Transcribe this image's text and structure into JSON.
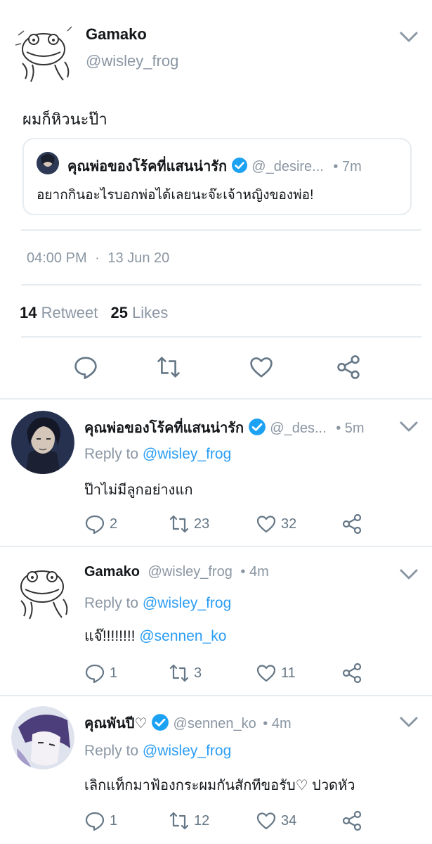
{
  "main_tweet": {
    "display_name": "Gamako",
    "handle": "@wisley_frog",
    "text": "ผมก็หิวนะป๊า",
    "quoted": {
      "display_name": "คุณพ่อของโร้คที่แสนน่ารัก",
      "handle": "@_desire...",
      "time": "• 7m",
      "text": "อยากกินอะไรบอกพ่อได้เลยนะจ๊ะเจ้าหญิงของพ่อ!"
    },
    "timestamp": "04:00 PM",
    "date_sep": "·",
    "date": "13 Jun 20",
    "retweet_count": "14",
    "retweet_label": "Retweet",
    "likes_count": "25",
    "likes_label": "Likes",
    "icons": [
      "reply-icon",
      "retweet-icon",
      "like-icon",
      "share-icon"
    ]
  },
  "replies": [
    {
      "display_name": "คุณพ่อของโร้คที่แสนน่ารัก",
      "handle": "@_des...",
      "time": "• 5m",
      "reply_prefix": "Reply to",
      "reply_to": "@wisley_frog",
      "text": "ป๊าไม่มีลูกอย่างแก",
      "mention": "",
      "replies": "2",
      "retweets": "23",
      "likes": "32"
    },
    {
      "display_name": "Gamako",
      "handle": "@wisley_frog",
      "time": "• 4m",
      "reply_prefix": "Reply to",
      "reply_to": "@wisley_frog",
      "text": "แจ๊!!!!!!!!",
      "mention": "@sennen_ko",
      "replies": "1",
      "retweets": "3",
      "likes": "11"
    },
    {
      "display_name": "คุณพันปี♡",
      "handle": "@sennen_ko",
      "time": "• 4m",
      "reply_prefix": "Reply to",
      "reply_to": "@wisley_frog",
      "text": "เลิกแท็กมาฟ้องกระผมกันสักทีขอรับ♡ ปวดหัว",
      "mention": "",
      "replies": "1",
      "retweets": "12",
      "likes": "34"
    }
  ],
  "colors": {
    "link": "#2a9df4",
    "verified": "#1da1f2",
    "muted": "#8a96a3",
    "divider": "#e6ecf0"
  }
}
